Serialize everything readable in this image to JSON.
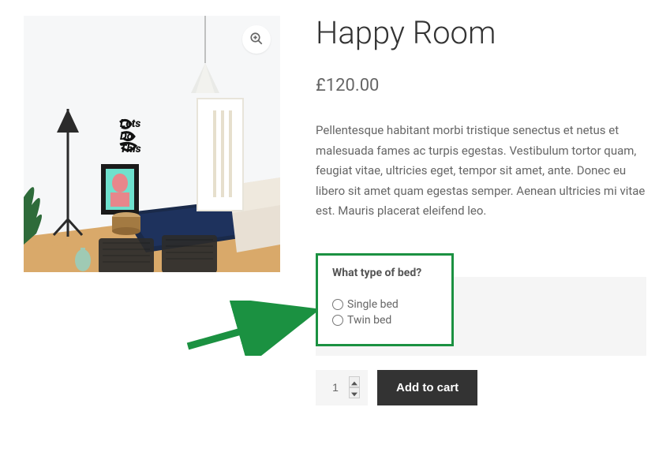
{
  "product": {
    "title": "Happy Room",
    "currency": "£",
    "price": "120.00",
    "description": "Pellentesque habitant morbi tristique senectus et netus et malesuada fames ac turpis egestas. Vestibulum tortor quam, feugiat vitae, ultricies eget, tempor sit amet, ante. Donec eu libero sit amet quam egestas semper. Aenean ultricies mi vitae est. Mauris placerat eleifend leo."
  },
  "options": {
    "label": "What type of bed?",
    "choices": {
      "single": "Single bed",
      "twin": "Twin bed"
    }
  },
  "cart": {
    "quantity": "1",
    "add_label": "Add to cart"
  },
  "colors": {
    "highlight": "#1b9141",
    "text_main": "#333",
    "text_muted": "#666"
  }
}
